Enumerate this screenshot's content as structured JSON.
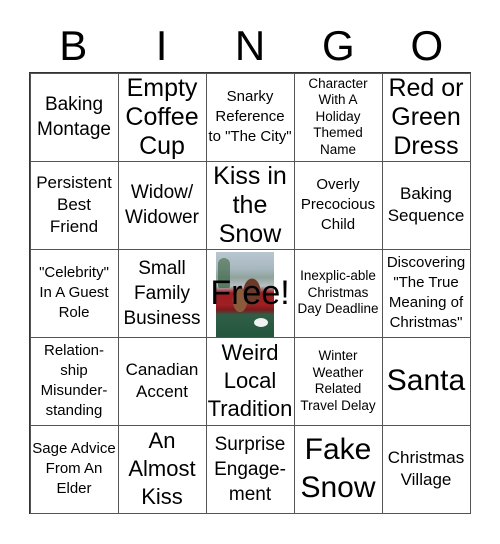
{
  "header": {
    "letters": [
      "B",
      "I",
      "N",
      "G",
      "O"
    ]
  },
  "free_space": {
    "label": "Free!",
    "image": "movie-poster"
  },
  "cells": [
    [
      "Baking Montage",
      "Empty Coffee Cup",
      "Snarky Reference to \"The City\"",
      "Character With A Holiday Themed Name",
      "Red or Green Dress"
    ],
    [
      "Persistent Best Friend",
      "Widow/ Widower",
      "Kiss in the Snow",
      "Overly Precocious Child",
      "Baking Sequence"
    ],
    [
      "\"Celebrity\" In A Guest Role",
      "Small Family Business",
      "Free!",
      "Inexplic-able Christmas Day Deadline",
      "Discovering \"The True Meaning of Christmas\""
    ],
    [
      "Relation-ship Misunder-standing",
      "Canadian Accent",
      "Weird Local Tradition",
      "Winter Weather Related Travel Delay",
      "Santa"
    ],
    [
      "Sage Advice From An Elder",
      "An Almost Kiss",
      "Surprise Engage-ment",
      "Fake Snow",
      "Christmas Village"
    ]
  ]
}
